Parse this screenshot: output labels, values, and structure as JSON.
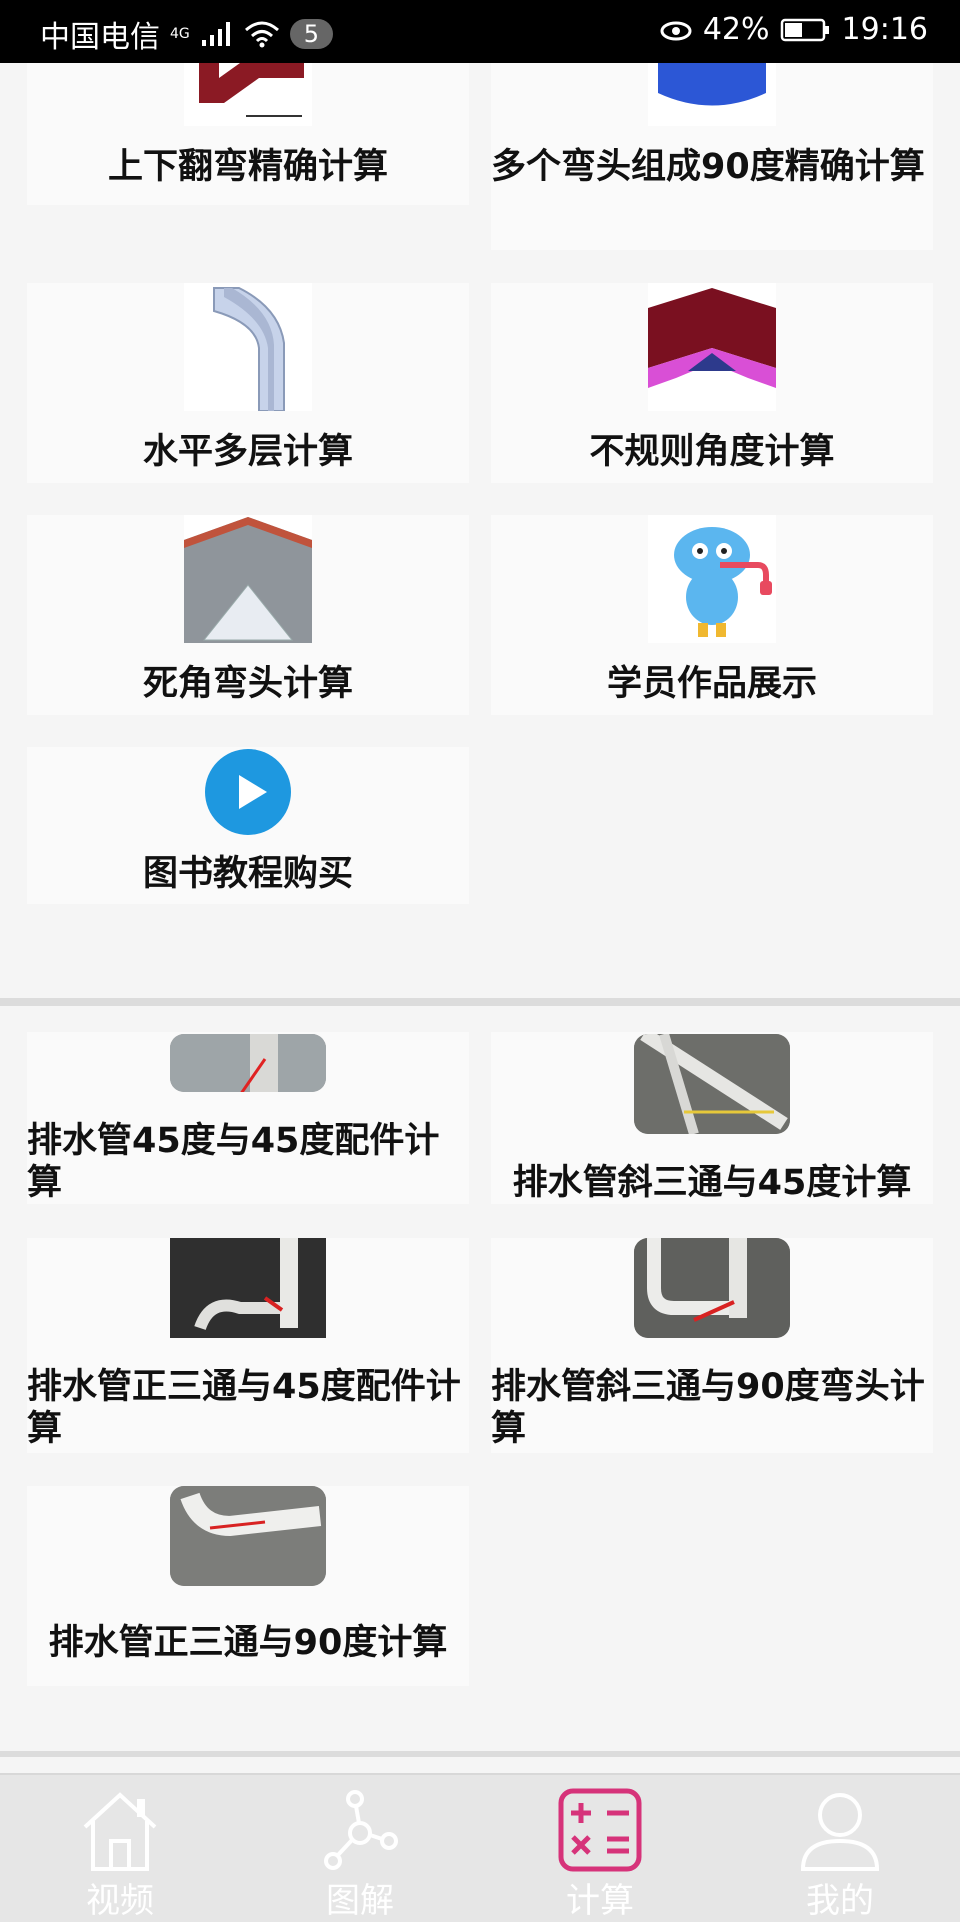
{
  "status_bar": {
    "carrier": "中国电信",
    "network": "4G",
    "notification_count": "5",
    "battery": "42%",
    "time": "19:16"
  },
  "section1": {
    "cards": [
      {
        "title": "上下翻弯精确计算",
        "icon": "offset-bend-diagram"
      },
      {
        "title": "多个弯头组成90度精确计算",
        "icon": "multi-elbow-diagram"
      },
      {
        "title": "水平多层计算",
        "icon": "horizontal-multilayer-diagram"
      },
      {
        "title": "不规则角度计算",
        "icon": "irregular-angle-diagram"
      },
      {
        "title": "死角弯头计算",
        "icon": "dead-angle-elbow-diagram"
      },
      {
        "title": "学员作品展示",
        "icon": "student-mascot"
      },
      {
        "title": "图书教程购买",
        "icon": "play-icon"
      }
    ]
  },
  "section2": {
    "cards": [
      {
        "title": "排水管45度与45度配件计算",
        "icon": "pipe-photo"
      },
      {
        "title": "排水管斜三通与45度计算",
        "icon": "pipe-photo"
      },
      {
        "title": "排水管正三通与45度配件计算",
        "icon": "pipe-photo"
      },
      {
        "title": "排水管斜三通与90度弯头计算",
        "icon": "pipe-photo"
      },
      {
        "title": "排水管正三通与90度计算",
        "icon": "pipe-photo"
      }
    ]
  },
  "bottom_nav": {
    "items": [
      {
        "label": "视频",
        "icon": "home-icon"
      },
      {
        "label": "图解",
        "icon": "diagram-icon"
      },
      {
        "label": "计算",
        "icon": "calculator-icon",
        "active": true
      },
      {
        "label": "我的",
        "icon": "user-icon"
      }
    ],
    "active_color": "#d6337a"
  }
}
